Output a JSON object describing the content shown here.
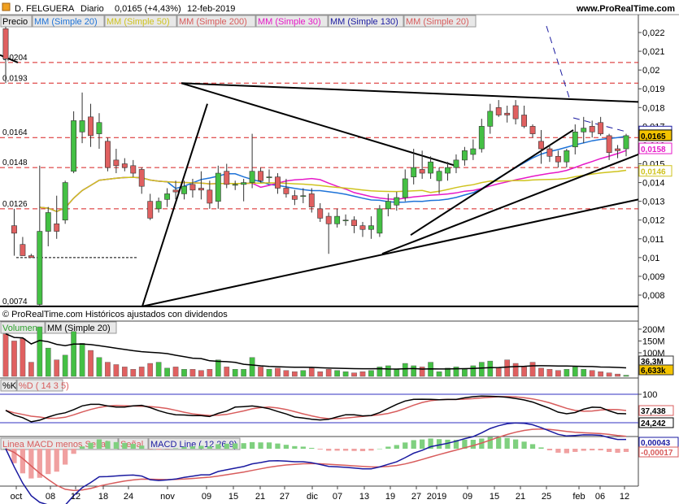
{
  "header": {
    "symbol": "D. FELGUERA",
    "period": "Diario",
    "last_quote": "0,0165 (+4,43%)",
    "date": "12-feb-2019",
    "site": "www.ProRealTime.com"
  },
  "price_panel": {
    "title": "Precio",
    "legend": [
      {
        "label": "MM (Simple 20)",
        "color": "#1e73d8"
      },
      {
        "label": "MM (Simple 50)",
        "color": "#cfc31e"
      },
      {
        "label": "MM (Simple 200)",
        "color": "#d85c5c"
      },
      {
        "label": "MM (Simple 30)",
        "color": "#e619c8"
      },
      {
        "label": "MM (Simple 130)",
        "color": "#1a1aa0"
      },
      {
        "label": "MM (Simple 20)",
        "color": "#d85c5c"
      }
    ],
    "footer": "© ProRealTime.com  Históricos ajustados con dividendos",
    "y_ticks": [
      "0,022",
      "0,021",
      "0,02",
      "0,019",
      "0,018",
      "0,017",
      "0,016",
      "0,015",
      "0,014",
      "0,013",
      "0,012",
      "0,011",
      "0,01",
      "0,009",
      "0,008"
    ],
    "y_range": [
      0.0072,
      0.0228
    ],
    "level_labels": [
      "0,0204",
      "0,0193",
      "0,0164",
      "0,0148",
      "0,0126",
      "0,0074"
    ],
    "level_values": [
      0.0204,
      0.0193,
      0.0164,
      0.0148,
      0.0126,
      0.0074
    ],
    "resistance_lines": [
      0.0204,
      0.0193,
      0.0164,
      0.0148,
      0.0126
    ],
    "value_tags": [
      {
        "label": "0,0167",
        "value": 0.0167,
        "color": "#1a1aa0"
      },
      {
        "label": "0,0165",
        "value": 0.0165,
        "color": "#000000"
      },
      {
        "label": "0,0158",
        "value": 0.0158,
        "color": "#e619c8"
      },
      {
        "label": "0,0146",
        "value": 0.0146,
        "color": "#cfc31e"
      }
    ]
  },
  "volume_panel": {
    "title": "Volumen",
    "legend": "MM (Simple 20)",
    "y_ticks": [
      "200M",
      "150M",
      "100M",
      "50M"
    ],
    "value_tags": [
      "36,3M",
      "6,633k"
    ]
  },
  "stoch_panel": {
    "title": "%K",
    "legend": "%D ( 14 3 5)",
    "y_ticks": [
      "100",
      "0"
    ],
    "value_tags": [
      "37,438",
      "24,242"
    ]
  },
  "macd_panel": {
    "legend": [
      "Linea MACD menos Señal",
      "Señal",
      "MACD Line ( 12 26 9)"
    ],
    "value_tags": [
      "0,00043",
      "-0,00017"
    ]
  },
  "x_axis": {
    "labels": [
      "oct",
      "08",
      "12",
      "18",
      "24",
      "nov",
      "09",
      "15",
      "21",
      "27",
      "dic",
      "07",
      "13",
      "19",
      "27",
      "2019",
      "09",
      "15",
      "21",
      "25",
      "feb",
      "06",
      "12"
    ]
  },
  "chart_data": {
    "type": "candlestick",
    "title": "D. FELGUERA Diario",
    "y_range": [
      0.0072,
      0.0228
    ],
    "candles": [
      {
        "o": 0.0222,
        "h": 0.0223,
        "l": 0.0193,
        "c": 0.0206
      },
      {
        "o": 0.0117,
        "h": 0.0126,
        "l": 0.0101,
        "c": 0.0113
      },
      {
        "o": 0.0107,
        "h": 0.0111,
        "l": 0.0101,
        "c": 0.0101
      },
      {
        "o": 0.0101,
        "h": 0.0102,
        "l": 0.01,
        "c": 0.01
      },
      {
        "o": 0.0075,
        "h": 0.0149,
        "l": 0.0074,
        "c": 0.0114
      },
      {
        "o": 0.0114,
        "h": 0.0127,
        "l": 0.0106,
        "c": 0.0124
      },
      {
        "o": 0.0118,
        "h": 0.0133,
        "l": 0.011,
        "c": 0.0114
      },
      {
        "o": 0.012,
        "h": 0.0141,
        "l": 0.0118,
        "c": 0.014
      },
      {
        "o": 0.0146,
        "h": 0.0178,
        "l": 0.0145,
        "c": 0.0173
      },
      {
        "o": 0.0167,
        "h": 0.0188,
        "l": 0.0161,
        "c": 0.0173
      },
      {
        "o": 0.0175,
        "h": 0.0182,
        "l": 0.0159,
        "c": 0.0165
      },
      {
        "o": 0.0166,
        "h": 0.0177,
        "l": 0.0158,
        "c": 0.0172
      },
      {
        "o": 0.0162,
        "h": 0.0164,
        "l": 0.0146,
        "c": 0.0148
      },
      {
        "o": 0.0152,
        "h": 0.0158,
        "l": 0.0145,
        "c": 0.0149
      },
      {
        "o": 0.015,
        "h": 0.0153,
        "l": 0.0146,
        "c": 0.0148
      },
      {
        "o": 0.0149,
        "h": 0.0152,
        "l": 0.0143,
        "c": 0.0145
      },
      {
        "o": 0.0147,
        "h": 0.0148,
        "l": 0.0134,
        "c": 0.0138
      },
      {
        "o": 0.013,
        "h": 0.0134,
        "l": 0.012,
        "c": 0.0121
      },
      {
        "o": 0.0126,
        "h": 0.0132,
        "l": 0.0124,
        "c": 0.013
      },
      {
        "o": 0.0131,
        "h": 0.0137,
        "l": 0.0127,
        "c": 0.0134
      },
      {
        "o": 0.0136,
        "h": 0.0141,
        "l": 0.0131,
        "c": 0.0135
      },
      {
        "o": 0.0134,
        "h": 0.0141,
        "l": 0.0131,
        "c": 0.0138
      },
      {
        "o": 0.0139,
        "h": 0.0142,
        "l": 0.0132,
        "c": 0.0136
      },
      {
        "o": 0.0137,
        "h": 0.0146,
        "l": 0.0131,
        "c": 0.0136
      },
      {
        "o": 0.0136,
        "h": 0.0141,
        "l": 0.0126,
        "c": 0.0129
      },
      {
        "o": 0.013,
        "h": 0.0149,
        "l": 0.0126,
        "c": 0.0145
      },
      {
        "o": 0.0146,
        "h": 0.015,
        "l": 0.0137,
        "c": 0.0139
      },
      {
        "o": 0.0139,
        "h": 0.0141,
        "l": 0.0136,
        "c": 0.0139
      },
      {
        "o": 0.0139,
        "h": 0.0142,
        "l": 0.013,
        "c": 0.014
      },
      {
        "o": 0.014,
        "h": 0.0166,
        "l": 0.0137,
        "c": 0.0146
      },
      {
        "o": 0.0146,
        "h": 0.0148,
        "l": 0.014,
        "c": 0.0141
      },
      {
        "o": 0.0143,
        "h": 0.0147,
        "l": 0.014,
        "c": 0.0143
      },
      {
        "o": 0.0143,
        "h": 0.0145,
        "l": 0.0134,
        "c": 0.0137
      },
      {
        "o": 0.0137,
        "h": 0.0142,
        "l": 0.0132,
        "c": 0.0134
      },
      {
        "o": 0.0133,
        "h": 0.0136,
        "l": 0.0128,
        "c": 0.0131
      },
      {
        "o": 0.0133,
        "h": 0.0137,
        "l": 0.0129,
        "c": 0.0133
      },
      {
        "o": 0.0134,
        "h": 0.0137,
        "l": 0.0124,
        "c": 0.0127
      },
      {
        "o": 0.0126,
        "h": 0.0129,
        "l": 0.0119,
        "c": 0.0121
      },
      {
        "o": 0.0122,
        "h": 0.0124,
        "l": 0.0102,
        "c": 0.0118
      },
      {
        "o": 0.0118,
        "h": 0.0126,
        "l": 0.0116,
        "c": 0.0122
      },
      {
        "o": 0.012,
        "h": 0.0123,
        "l": 0.0117,
        "c": 0.012
      },
      {
        "o": 0.012,
        "h": 0.0122,
        "l": 0.0113,
        "c": 0.0117
      },
      {
        "o": 0.0117,
        "h": 0.0119,
        "l": 0.0111,
        "c": 0.0115
      },
      {
        "o": 0.0115,
        "h": 0.0122,
        "l": 0.011,
        "c": 0.0117
      },
      {
        "o": 0.0113,
        "h": 0.0128,
        "l": 0.0111,
        "c": 0.0126
      },
      {
        "o": 0.0126,
        "h": 0.0134,
        "l": 0.0122,
        "c": 0.013
      },
      {
        "o": 0.0128,
        "h": 0.0135,
        "l": 0.0125,
        "c": 0.0132
      },
      {
        "o": 0.0132,
        "h": 0.0147,
        "l": 0.013,
        "c": 0.0142
      },
      {
        "o": 0.0143,
        "h": 0.0158,
        "l": 0.0139,
        "c": 0.0148
      },
      {
        "o": 0.0147,
        "h": 0.0157,
        "l": 0.0142,
        "c": 0.0145
      },
      {
        "o": 0.0145,
        "h": 0.0154,
        "l": 0.0142,
        "c": 0.0151
      },
      {
        "o": 0.0141,
        "h": 0.0148,
        "l": 0.0134,
        "c": 0.0146
      },
      {
        "o": 0.0145,
        "h": 0.0151,
        "l": 0.0141,
        "c": 0.0148
      },
      {
        "o": 0.0148,
        "h": 0.0155,
        "l": 0.0145,
        "c": 0.0152
      },
      {
        "o": 0.0152,
        "h": 0.0159,
        "l": 0.0149,
        "c": 0.0157
      },
      {
        "o": 0.0155,
        "h": 0.0163,
        "l": 0.0152,
        "c": 0.0158
      },
      {
        "o": 0.0158,
        "h": 0.0174,
        "l": 0.0156,
        "c": 0.017
      },
      {
        "o": 0.017,
        "h": 0.0182,
        "l": 0.0166,
        "c": 0.0178
      },
      {
        "o": 0.018,
        "h": 0.0184,
        "l": 0.0175,
        "c": 0.0176
      },
      {
        "o": 0.0177,
        "h": 0.0181,
        "l": 0.0172,
        "c": 0.0176
      },
      {
        "o": 0.0181,
        "h": 0.0184,
        "l": 0.0171,
        "c": 0.0174
      },
      {
        "o": 0.0176,
        "h": 0.0181,
        "l": 0.0169,
        "c": 0.017
      },
      {
        "o": 0.017,
        "h": 0.0171,
        "l": 0.0164,
        "c": 0.0166
      },
      {
        "o": 0.0162,
        "h": 0.0168,
        "l": 0.015,
        "c": 0.0158
      },
      {
        "o": 0.0158,
        "h": 0.016,
        "l": 0.0151,
        "c": 0.0154
      },
      {
        "o": 0.0154,
        "h": 0.0157,
        "l": 0.0148,
        "c": 0.0151
      },
      {
        "o": 0.0151,
        "h": 0.0158,
        "l": 0.0148,
        "c": 0.0157
      },
      {
        "o": 0.0159,
        "h": 0.0171,
        "l": 0.0155,
        "c": 0.0167
      },
      {
        "o": 0.0167,
        "h": 0.0175,
        "l": 0.0161,
        "c": 0.0169
      },
      {
        "o": 0.017,
        "h": 0.0173,
        "l": 0.0164,
        "c": 0.0167
      },
      {
        "o": 0.0172,
        "h": 0.0175,
        "l": 0.0165,
        "c": 0.0166
      },
      {
        "o": 0.0165,
        "h": 0.0166,
        "l": 0.0152,
        "c": 0.0156
      },
      {
        "o": 0.0158,
        "h": 0.016,
        "l": 0.0153,
        "c": 0.0157
      },
      {
        "o": 0.0158,
        "h": 0.0166,
        "l": 0.0154,
        "c": 0.0165
      }
    ],
    "volume": [
      180,
      150,
      160,
      60,
      210,
      120,
      70,
      90,
      190,
      140,
      110,
      80,
      60,
      50,
      40,
      30,
      40,
      55,
      60,
      35,
      40,
      30,
      30,
      25,
      30,
      70,
      40,
      30,
      30,
      80,
      40,
      30,
      35,
      25,
      20,
      25,
      35,
      20,
      30,
      25,
      20,
      15,
      20,
      25,
      40,
      45,
      30,
      55,
      45,
      40,
      60,
      20,
      35,
      40,
      30,
      45,
      60,
      65,
      35,
      70,
      55,
      40,
      60,
      35,
      30,
      25,
      30,
      40,
      30,
      25,
      20,
      15,
      10,
      5
    ]
  }
}
